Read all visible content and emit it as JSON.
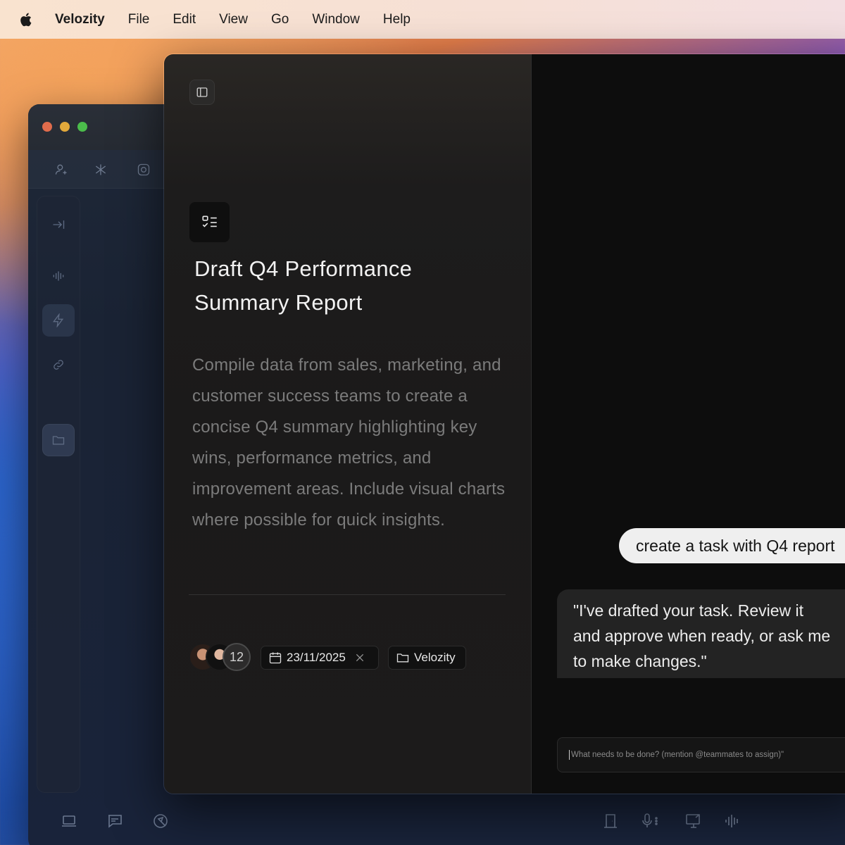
{
  "menubar": {
    "app_name": "Velozity",
    "items": [
      "File",
      "Edit",
      "View",
      "Go",
      "Window",
      "Help"
    ]
  },
  "background_window": {
    "toolbar_icons": [
      "add-user-icon",
      "brand-icon",
      "camera-icon"
    ],
    "sidebar_icons": [
      "collapse-icon",
      "waveform-icon",
      "lightning-icon",
      "link-icon",
      "folder-icon"
    ],
    "bottom_icons": [
      "laptop-icon",
      "chat-icon",
      "cursor-chat-icon",
      "door-icon",
      "microphone-icon",
      "screen-share-icon",
      "audio-bars-icon"
    ]
  },
  "task": {
    "title": "Draft Q4 Performance Summary Report",
    "description": "Compile data from sales, marketing, and customer success teams to create a concise Q4 summary highlighting key wins, performance metrics, and improvement areas. Include visual charts where possible for quick insights.",
    "assignee_count": "12",
    "due_date": "23/11/2025",
    "project": "Velozity"
  },
  "chat": {
    "user_message": "create a task with Q4 report",
    "assistant_message_line1": "\"I've drafted your task. Review it",
    "assistant_message_line2": "and approve when ready, or ask me",
    "assistant_message_line3": "to make changes.\"",
    "input_placeholder": "What needs to be done? (mention @teammates to assign)\""
  },
  "colors": {
    "chat_background": "#0d0d0d",
    "task_pane_background": "#1c1b1b",
    "user_bubble": "#efefef",
    "assistant_bubble": "#232323"
  }
}
